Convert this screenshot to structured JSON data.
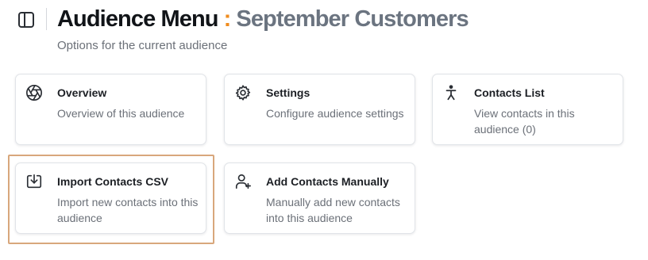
{
  "header": {
    "title_main": "Audience Menu",
    "title_separator": ":",
    "title_audience": "September Customers",
    "subtitle": "Options for the current audience",
    "toggle_icon": "sidebar-toggle-icon"
  },
  "cards": [
    {
      "title": "Overview",
      "description": "Overview of this audience",
      "icon": "aperture-icon"
    },
    {
      "title": "Settings",
      "description": "Configure audience settings",
      "icon": "gear-icon"
    },
    {
      "title": "Contacts List",
      "description": "View contacts in this audience (0)",
      "icon": "person-icon"
    },
    {
      "title": "Import Contacts CSV",
      "description": "Import new contacts into this audience",
      "icon": "import-icon",
      "selected": true
    },
    {
      "title": "Add Contacts Manually",
      "description": "Manually add new contacts into this audience",
      "icon": "user-plus-icon"
    }
  ],
  "colors": {
    "accent_separator": "#f08c1e",
    "audience_name": "#6b7480",
    "selection_outline": "#d8a77c"
  }
}
